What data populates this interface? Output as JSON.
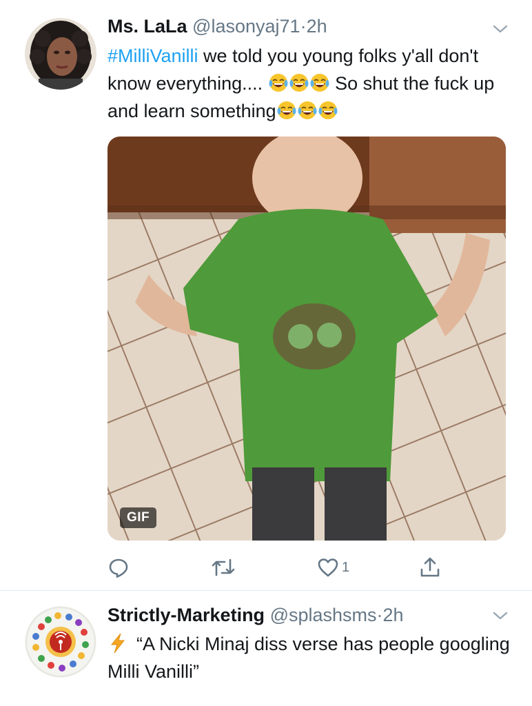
{
  "tweets": [
    {
      "name": "Ms. LaLa",
      "handle": "@lasonyaj71",
      "separator": "·",
      "time": "2h",
      "hashtag": "#MilliVanilli",
      "text_part1": " we told you young folks y'all don't know everything....",
      "text_part2": "So shut the fuck up and learn something",
      "media_badge": "GIF",
      "like_count": "1",
      "icons": [
        "reply-icon",
        "retweet-icon",
        "like-icon",
        "share-icon"
      ]
    },
    {
      "name": "Strictly-Marketing",
      "handle": "@splashsms",
      "separator": "·",
      "time": "2h",
      "text": "“A Nicki Minaj diss verse has people googling Milli Vanilli”",
      "icons": [
        "lightning-bolt-icon"
      ]
    }
  ],
  "colors": {
    "link": "#1da1f2",
    "muted": "#657786",
    "divider": "#e1e8ed",
    "bolt": "#f5a623"
  }
}
